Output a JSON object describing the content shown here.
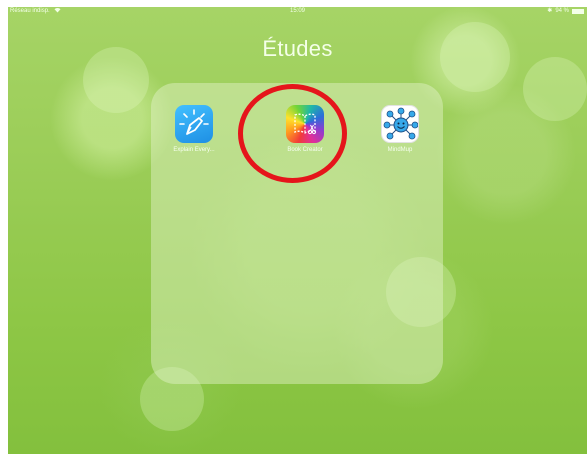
{
  "status_bar": {
    "carrier": "Réseau indisp.",
    "time": "15:09",
    "battery_percent": "94 %"
  },
  "folder": {
    "title": "Études",
    "apps": [
      {
        "label": "Explain Every...",
        "icon": "explain-everything-icon"
      },
      {
        "label": "Book Creator",
        "icon": "book-creator-icon"
      },
      {
        "label": "MindMup",
        "icon": "mindmup-icon"
      }
    ]
  },
  "annotation": {
    "color": "#e5151b",
    "target": "Book Creator"
  }
}
